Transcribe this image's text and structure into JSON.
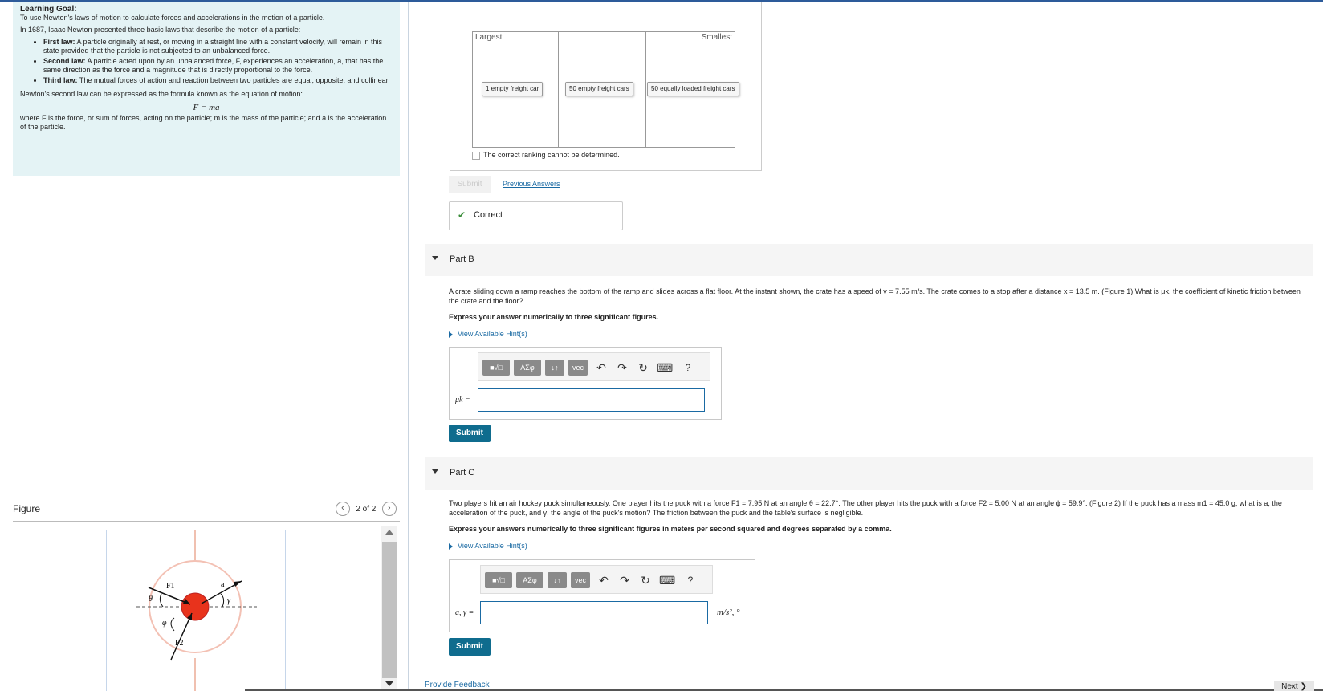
{
  "learning_goal": {
    "heading": "Learning Goal:",
    "goal": "To use Newton's laws of motion to calculate forces and accelerations in the motion of a particle.",
    "intro": "In 1687, Isaac Newton presented three basic laws that describe the motion of a particle:",
    "laws": [
      {
        "name": "First law:",
        "text": "A particle originally at rest, or moving in a straight line with a constant velocity, will remain in this state provided that the particle is not subjected to an unbalanced force."
      },
      {
        "name": "Second law:",
        "text": "A particle acted upon by an unbalanced force, F, experiences an acceleration, a, that has the same direction as the force and a magnitude that is directly proportional to the force."
      },
      {
        "name": "Third law:",
        "text": "The mutual forces of action and reaction between two particles are equal, opposite, and collinear"
      }
    ],
    "second_law_intro": "Newton's second law can be expressed as the formula known as the equation of motion:",
    "formula": "F = ma",
    "where": "where F is the force, or sum of forces, acting on the particle; m is the mass of the particle; and a is the acceleration of the particle."
  },
  "figure": {
    "label": "Figure",
    "pager": "2 of 2",
    "labels": {
      "f1": "F1",
      "f2": "F2",
      "a": "a",
      "theta": "θ",
      "phi": "φ",
      "gamma": "γ"
    }
  },
  "part_a": {
    "largest": "Largest",
    "smallest": "Smallest",
    "items": [
      "1 empty freight car",
      "50 empty freight cars",
      "50 equally loaded freight cars"
    ],
    "cannot_determine": "The correct ranking cannot be determined.",
    "submit": "Submit",
    "previous_answers": "Previous Answers",
    "feedback": "Correct",
    "feedback_icon": "✔"
  },
  "part_b": {
    "title": "Part B",
    "question": "A crate sliding down a ramp reaches the bottom of the ramp and slides across a flat floor. At the instant shown, the crate has a speed of v = 7.55 m/s. The crate comes to a stop after a distance x = 13.5 m. (Figure 1) What is μk, the coefficient of kinetic friction between the crate and the floor?",
    "instruction": "Express your answer numerically to three significant figures.",
    "hints": "View Available Hint(s)",
    "input_label": "μk =",
    "input_value": "",
    "submit": "Submit"
  },
  "part_c": {
    "title": "Part C",
    "question": "Two players hit an air hockey puck simultaneously. One player hits the puck with a force F1 = 7.95 N at an angle θ = 22.7°. The other player hits the puck with a force F2 = 5.00 N at an angle ϕ = 59.9°. (Figure 2) If the puck has a mass m1 = 45.0 g, what is a, the acceleration of the puck, and γ, the angle of the puck's motion? The friction between the puck and the table's surface is negligible.",
    "instruction": "Express your answers numerically to three significant figures in meters per second squared and degrees separated by a comma.",
    "hints": "View Available Hint(s)",
    "input_label": "a, γ =",
    "input_value": "",
    "units": "m/s², °",
    "submit": "Submit"
  },
  "toolbar": {
    "templates": "■√□",
    "greek": "ΑΣφ",
    "arrows": "↓↑",
    "vec": "vec",
    "undo": "↶",
    "redo": "↷",
    "reset": "↻",
    "keyboard": "⌨",
    "help": "?"
  },
  "footer": {
    "provide_feedback": "Provide Feedback",
    "next": "Next ❯"
  },
  "colors": {
    "accent": "#0f6c8e",
    "goal_bg": "#e4f3f5",
    "correct": "#3a8d3a",
    "puck": "#e8331c"
  }
}
